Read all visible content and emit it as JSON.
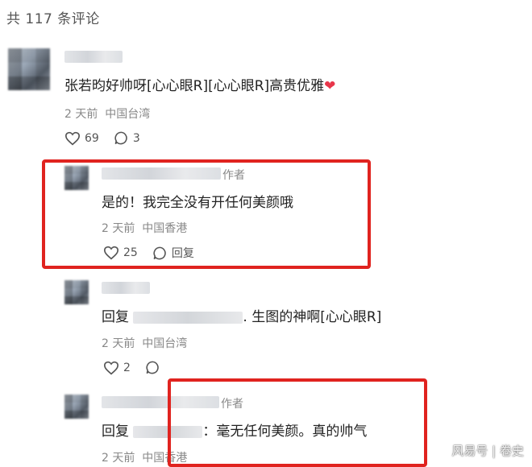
{
  "header": {
    "comment_count": "共 117 条评论"
  },
  "comments": [
    {
      "text_prefix": "张若昀好帅呀[心心眼R][心心眼R]高贵优雅",
      "emoji": "❤",
      "time": "2 天前",
      "location": "中国台湾",
      "likes": "69",
      "replies": "3"
    }
  ],
  "replies": [
    {
      "author_tag": "作者",
      "text": "是的！我完全没有开任何美颜哦",
      "time": "2 天前",
      "location": "中国香港",
      "likes": "25",
      "reply_label": "回复"
    },
    {
      "reply_prefix": "回复",
      "text_suffix": ". 生图的神啊[心心眼R]",
      "time": "2 天前",
      "location": "中国台湾",
      "likes": "2"
    },
    {
      "author_tag": "作者",
      "reply_prefix": "回复",
      "text_suffix": "：毫无任何美颜。真的帅气",
      "time": "2 天前",
      "location": "中国香港"
    }
  ],
  "watermark": "风易号 | 卷史",
  "colors": {
    "highlight": "#e0231f",
    "meta": "#888888",
    "text": "#222222"
  },
  "icons": [
    "heart-outline-icon",
    "comment-bubble-icon"
  ]
}
